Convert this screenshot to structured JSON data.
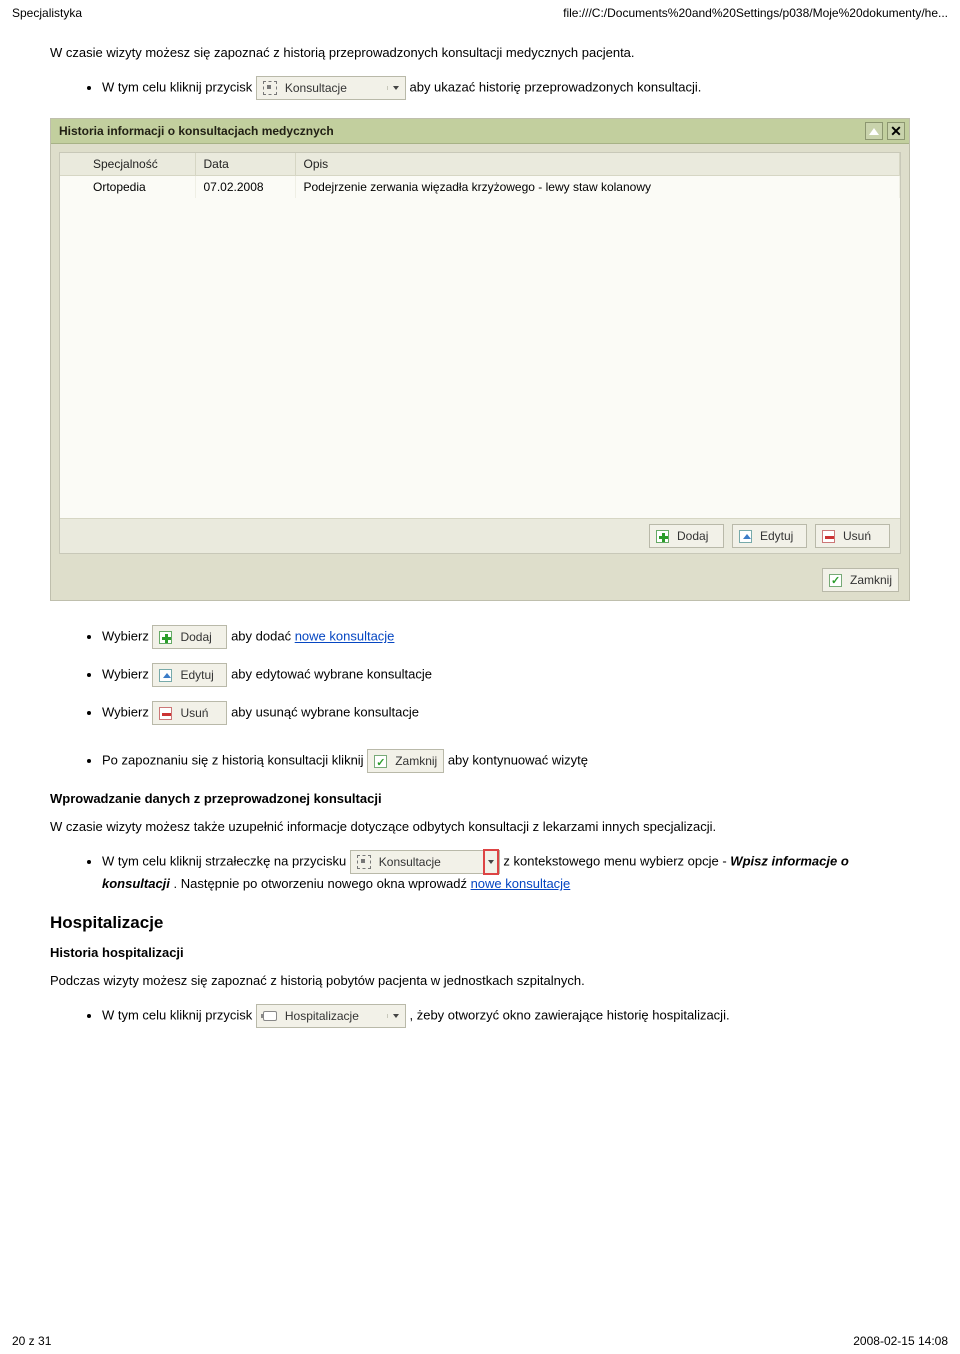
{
  "header": {
    "left": "Specjalistyka",
    "right": "file:///C:/Documents%20and%20Settings/p038/Moje%20dokumenty/he..."
  },
  "intro_para": "W czasie wizyty możesz się zapoznać z historią przeprowadzonych konsultacji medycznych pacjenta.",
  "bullet1_pre": "W tym celu kliknij przycisk ",
  "bullet1_post": " aby ukazać historię przeprowadzonych konsultacji.",
  "konsult_btn_label": "Konsultacje",
  "panel": {
    "title": "Historia informacji o konsultacjach medycznych",
    "col_spec": "Specjalność",
    "col_date": "Data",
    "col_desc": "Opis",
    "row": {
      "spec": "Ortopedia",
      "date": "07.02.2008",
      "desc": "Podejrzenie zerwania więzadła krzyżowego - lewy staw kolanowy"
    },
    "btn_add": "Dodaj",
    "btn_edit": "Edytuj",
    "btn_del": "Usuń",
    "btn_close": "Zamknij"
  },
  "bul_add_pre": "Wybierz ",
  "bul_add_post": " aby dodać ",
  "link_new_consult": "nowe konsultacje",
  "bul_edit_pre": "Wybierz ",
  "bul_edit_post": " aby edytować wybrane konsultacje",
  "bul_del_pre": "Wybierz ",
  "bul_del_post": " aby usunąć wybrane konsultacje",
  "bul_close_pre": "Po zapoznaniu się z historią konsultacji kliknij ",
  "bul_close_post": " aby kontynuować wizytę",
  "wprow_heading": "Wprowadzanie danych z przeprowadzonej konsultacji",
  "wprow_para": "W czasie wizyty możesz także uzupełnić informacje dotyczące odbytych konsultacji z lekarzami innych specjalizacji.",
  "bul_arrow_pre": "W tym celu kliknij strzałeczkę na przycisku ",
  "bul_arrow_mid": " z kontekstowego menu wybierz opcje - ",
  "bul_arrow_em": "Wpisz informacje o konsultacji",
  "bul_arrow_post1": ". Następnie po otworzeniu nowego okna wprowadź ",
  "hosp_heading": "Hospitalizacje",
  "hosp_sub": "Historia hospitalizacji",
  "hosp_para": "Podczas wizyty możesz się zapoznać z historią pobytów pacjenta w jednostkach szpitalnych.",
  "bul_hosp_pre": "W tym celu kliknij przycisk ",
  "hosp_btn_label": "Hospitalizacje",
  "bul_hosp_post": ", żeby otworzyć okno zawierające historię hospitalizacji.",
  "footer": {
    "left": "20 z 31",
    "right": "2008-02-15 14:08"
  }
}
